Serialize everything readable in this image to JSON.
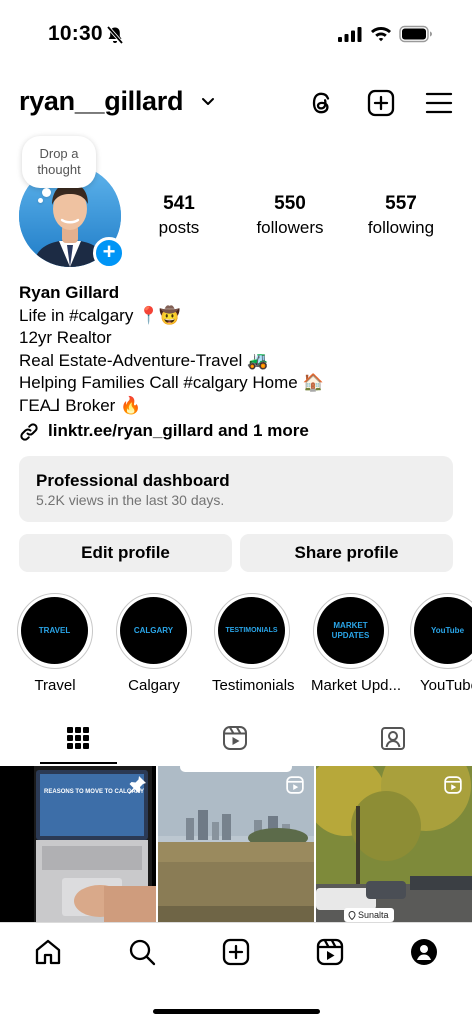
{
  "status_bar": {
    "time": "10:30"
  },
  "header": {
    "username": "ryan__gillard"
  },
  "profile": {
    "note": "Drop a thought",
    "stats": [
      {
        "value": "541",
        "label": "posts"
      },
      {
        "value": "550",
        "label": "followers"
      },
      {
        "value": "557",
        "label": "following"
      }
    ],
    "name": "Ryan Gillard",
    "bio_lines": [
      "Life in #calgary 📍🤠",
      "12yr Realtor",
      "Real Estate-Adventure-Travel 🚜",
      "Helping Families Call #calgary Home 🏠",
      "ΓEA⅃ Broker 🔥"
    ],
    "link": "linktr.ee/ryan_gillard and 1 more"
  },
  "dashboard": {
    "title": "Professional dashboard",
    "subtitle": "5.2K views in the last 30 days."
  },
  "buttons": {
    "edit": "Edit profile",
    "share": "Share profile"
  },
  "highlights": [
    {
      "cover": "TRAVEL",
      "caption": "Travel"
    },
    {
      "cover": "CALGARY",
      "caption": "Calgary"
    },
    {
      "cover": "TESTIMONIALS",
      "caption": "Testimonials"
    },
    {
      "cover": "MARKET UPDATES",
      "caption": "Market Upd..."
    },
    {
      "cover": "YouTube",
      "caption": "YouTube"
    }
  ],
  "grid": {
    "post1_overlay": "REASONS TO MOVE TO CALGARY",
    "post3_location": "Sunalta"
  },
  "colors": {
    "accent": "#0095f6",
    "highlight_text": "#2aa5e8",
    "button_bg": "#efefef"
  },
  "icons": {
    "header": [
      "threads-icon",
      "create-icon",
      "menu-icon"
    ],
    "tabs": [
      "grid-icon",
      "reels-icon",
      "tagged-icon"
    ],
    "bottom_nav": [
      "home-icon",
      "search-icon",
      "create-icon",
      "reels-icon",
      "profile-icon"
    ]
  }
}
